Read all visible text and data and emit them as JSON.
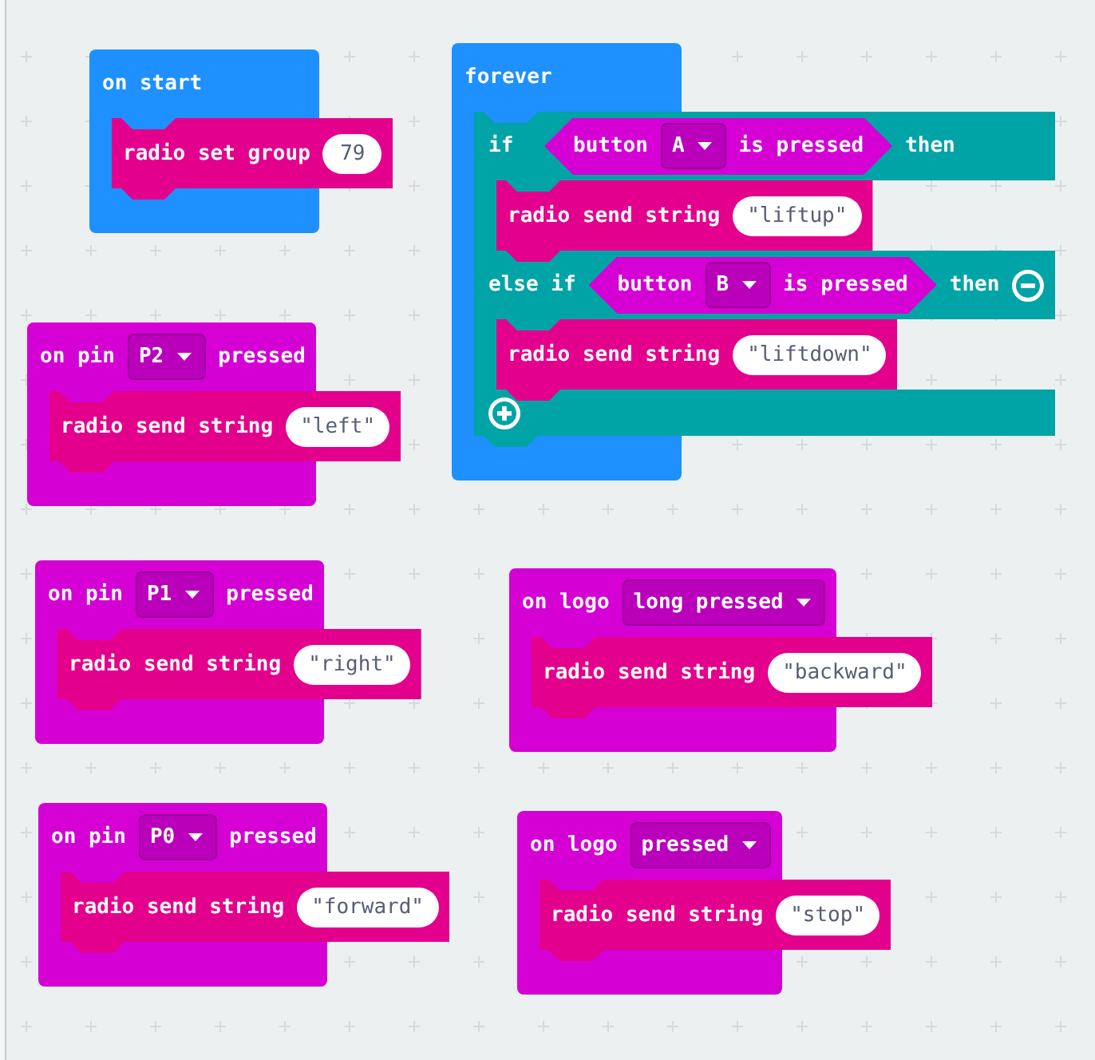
{
  "blocks": [
    {
      "color": "#1e90ff",
      "header": [
        {
          "kind": "label",
          "text": "on start"
        }
      ],
      "body": [
        {
          "kind": "statement",
          "color": "#e3008c",
          "parts": [
            {
              "kind": "label",
              "text": "radio set group"
            },
            {
              "kind": "input",
              "text": "79"
            }
          ]
        }
      ]
    },
    {
      "color": "#1e90ff",
      "header": [
        {
          "kind": "label",
          "text": "forever"
        }
      ],
      "body": [
        {
          "kind": "if",
          "color": "#00a4a6",
          "branches": [
            {
              "parts": [
                {
                  "kind": "label",
                  "text": "if"
                },
                {
                  "kind": "condition",
                  "color": "#d400d4",
                  "parts": [
                    {
                      "kind": "label",
                      "text": "button"
                    },
                    {
                      "kind": "dropdown",
                      "text": "A"
                    },
                    {
                      "kind": "label",
                      "text": "is pressed"
                    }
                  ]
                },
                {
                  "kind": "label",
                  "text": "then"
                }
              ],
              "body": [
                {
                  "kind": "statement",
                  "color": "#e3008c",
                  "parts": [
                    {
                      "kind": "label",
                      "text": "radio send string"
                    },
                    {
                      "kind": "input",
                      "text": "\"liftup\""
                    }
                  ]
                }
              ]
            },
            {
              "parts": [
                {
                  "kind": "label",
                  "text": "else if"
                },
                {
                  "kind": "condition",
                  "color": "#d400d4",
                  "parts": [
                    {
                      "kind": "label",
                      "text": "button"
                    },
                    {
                      "kind": "dropdown",
                      "text": "B"
                    },
                    {
                      "kind": "label",
                      "text": "is pressed"
                    }
                  ]
                },
                {
                  "kind": "label",
                  "text": "then"
                }
              ],
              "body": [
                {
                  "kind": "statement",
                  "color": "#e3008c",
                  "parts": [
                    {
                      "kind": "label",
                      "text": "radio send string"
                    },
                    {
                      "kind": "input",
                      "text": "\"liftdown\""
                    }
                  ]
                }
              ]
            }
          ]
        }
      ]
    },
    {
      "color": "#d400d4",
      "header": [
        {
          "kind": "label",
          "text": "on pin"
        },
        {
          "kind": "dropdown",
          "text": "P2"
        },
        {
          "kind": "label",
          "text": "pressed"
        }
      ],
      "body": [
        {
          "kind": "statement",
          "color": "#e3008c",
          "parts": [
            {
              "kind": "label",
              "text": "radio send string"
            },
            {
              "kind": "input",
              "text": "\"left\""
            }
          ]
        }
      ]
    },
    {
      "color": "#d400d4",
      "header": [
        {
          "kind": "label",
          "text": "on pin"
        },
        {
          "kind": "dropdown",
          "text": "P1"
        },
        {
          "kind": "label",
          "text": "pressed"
        }
      ],
      "body": [
        {
          "kind": "statement",
          "color": "#e3008c",
          "parts": [
            {
              "kind": "label",
              "text": "radio send string"
            },
            {
              "kind": "input",
              "text": "\"right\""
            }
          ]
        }
      ]
    },
    {
      "color": "#d400d4",
      "header": [
        {
          "kind": "label",
          "text": "on logo"
        },
        {
          "kind": "dropdown",
          "text": "long pressed"
        }
      ],
      "body": [
        {
          "kind": "statement",
          "color": "#e3008c",
          "parts": [
            {
              "kind": "label",
              "text": "radio send string"
            },
            {
              "kind": "input",
              "text": "\"backward\""
            }
          ]
        }
      ]
    },
    {
      "color": "#d400d4",
      "header": [
        {
          "kind": "label",
          "text": "on pin"
        },
        {
          "kind": "dropdown",
          "text": "P0"
        },
        {
          "kind": "label",
          "text": "pressed"
        }
      ],
      "body": [
        {
          "kind": "statement",
          "color": "#e3008c",
          "parts": [
            {
              "kind": "label",
              "text": "radio send string"
            },
            {
              "kind": "input",
              "text": "\"forward\""
            }
          ]
        }
      ]
    },
    {
      "color": "#d400d4",
      "header": [
        {
          "kind": "label",
          "text": "on logo"
        },
        {
          "kind": "dropdown",
          "text": "pressed"
        }
      ],
      "body": [
        {
          "kind": "statement",
          "color": "#e3008c",
          "parts": [
            {
              "kind": "label",
              "text": "radio send string"
            },
            {
              "kind": "input",
              "text": "\"stop\""
            }
          ]
        }
      ]
    }
  ]
}
